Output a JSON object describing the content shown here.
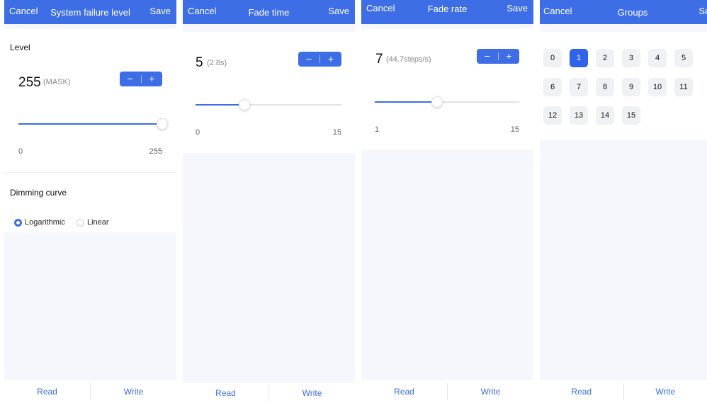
{
  "panels": [
    {
      "cancel": "Cancel",
      "title": "System failure level",
      "save": "Save",
      "section_label": "Level",
      "value": "255",
      "value_note": "(MASK)",
      "stepper": {
        "minus": "−",
        "plus": "+"
      },
      "slider": {
        "min": "0",
        "max": "255",
        "fraction": 1.0
      },
      "curve_label": "Dimming curve",
      "curve_options": [
        "Logarithmic",
        "Linear"
      ],
      "curve_selected": "Logarithmic",
      "read": "Read",
      "write": "Write"
    },
    {
      "cancel": "Cancel",
      "title": "Fade time",
      "save": "Save",
      "value": "5",
      "value_note": "(2.8s)",
      "stepper": {
        "minus": "−",
        "plus": "+"
      },
      "slider": {
        "min": "0",
        "max": "15",
        "fraction": 0.333
      },
      "read": "Read",
      "write": "Write"
    },
    {
      "cancel": "Cancel",
      "title": "Fade rate",
      "save": "Save",
      "value": "7",
      "value_note": "(44.7steps/s)",
      "stepper": {
        "minus": "−",
        "plus": "+"
      },
      "slider": {
        "min": "1",
        "max": "15",
        "fraction": 0.429
      },
      "read": "Read",
      "write": "Write"
    },
    {
      "cancel": "Cancel",
      "title": "Groups",
      "save": "Save",
      "groups": [
        "0",
        "1",
        "2",
        "3",
        "4",
        "5",
        "6",
        "7",
        "8",
        "9",
        "10",
        "11",
        "12",
        "13",
        "14",
        "15"
      ],
      "selected_group": "1",
      "read": "Read",
      "write": "Write"
    }
  ],
  "colors": {
    "accent": "#3d6ee6",
    "background_gray": "#f5f7fd"
  }
}
